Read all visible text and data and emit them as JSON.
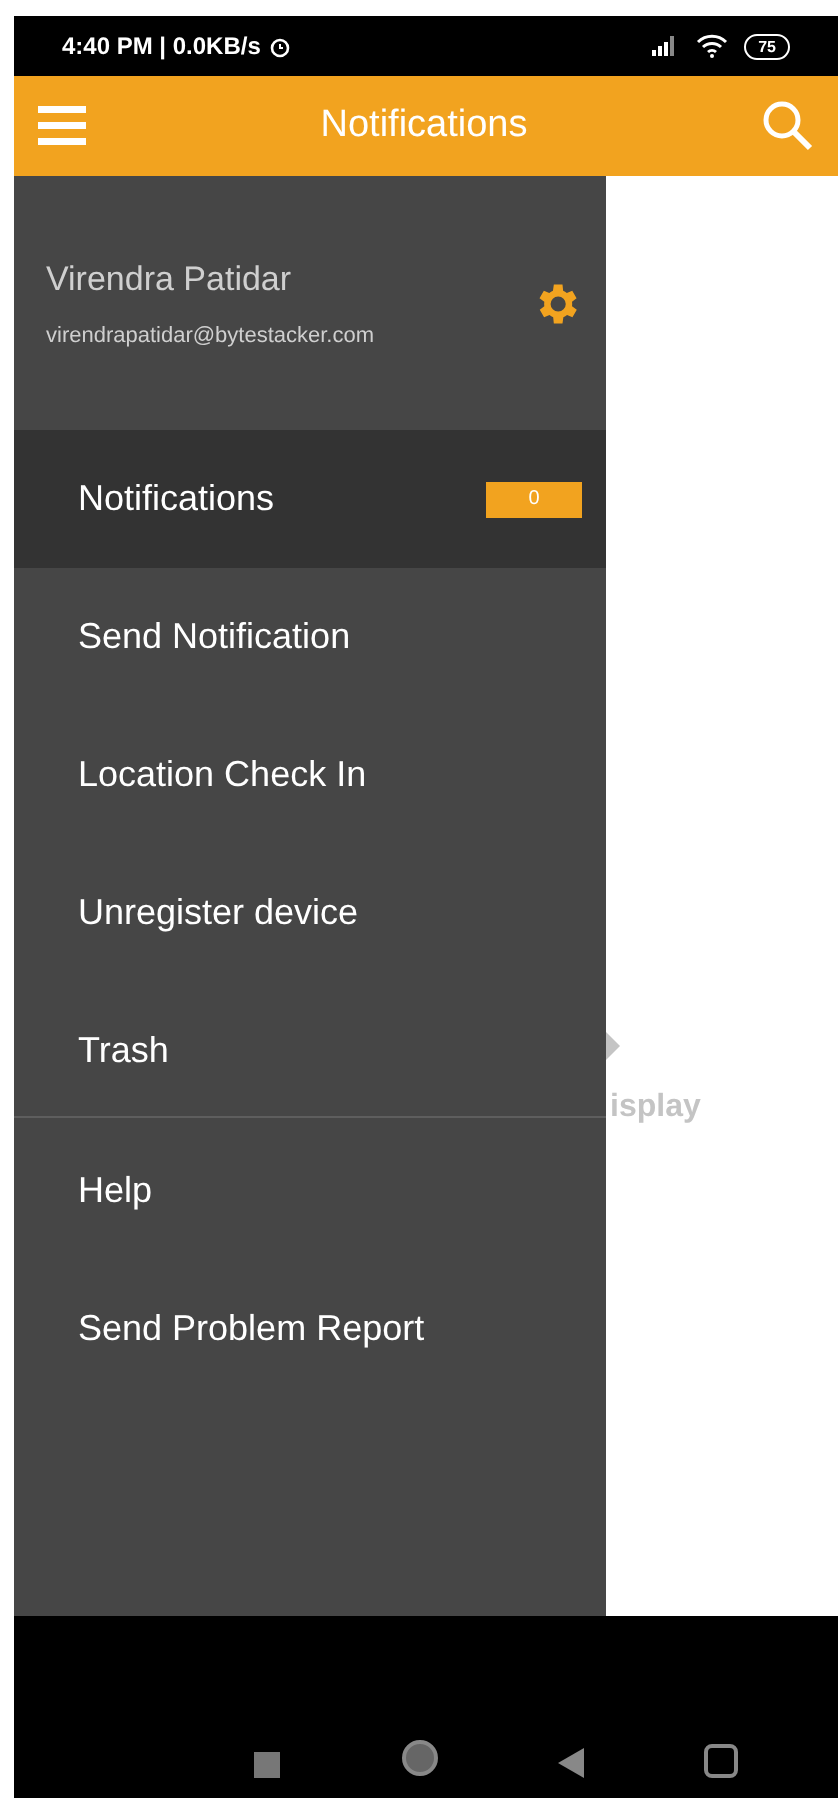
{
  "status_bar": {
    "time": "4:40 PM | 0.0KB/s",
    "battery": "75"
  },
  "app_bar": {
    "title": "Notifications"
  },
  "drawer": {
    "user_name": "Virendra Patidar",
    "user_email": "virendrapatidar@bytestacker.com",
    "items": [
      {
        "label": "Notifications",
        "selected": true,
        "badge": "0"
      },
      {
        "label": "Send Notification",
        "selected": false
      },
      {
        "label": "Location Check In",
        "selected": false
      },
      {
        "label": "Unregister device",
        "selected": false
      },
      {
        "label": "Trash",
        "selected": false
      }
    ],
    "secondary_items": [
      {
        "label": "Help",
        "selected": false
      },
      {
        "label": "Send Problem Report",
        "selected": false
      }
    ]
  },
  "empty_state": {
    "text": "isplay"
  }
}
